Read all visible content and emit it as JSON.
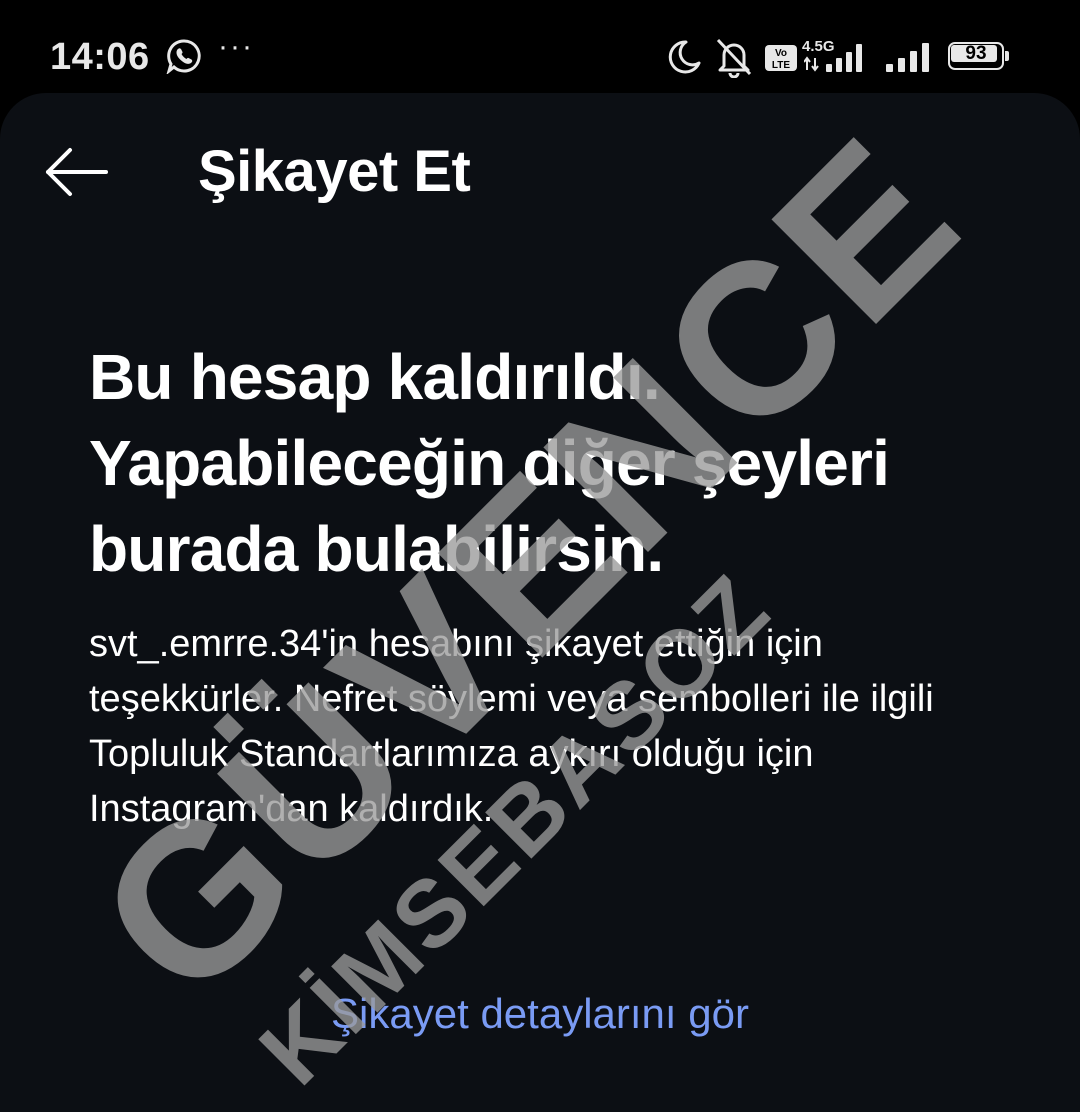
{
  "status_bar": {
    "time": "14:06",
    "dots": "···",
    "network_label": "4.5G",
    "volte_label": "Vo LTE",
    "battery_level": "93",
    "icons": [
      "whatsapp-icon",
      "moon-icon",
      "bell-muted-icon",
      "volte-icon",
      "signal-icon",
      "battery-icon"
    ]
  },
  "header": {
    "title": "Şikayet Et",
    "back_icon": "arrow-left-icon"
  },
  "main": {
    "headline": "Bu hesap kaldırıldı. Yapabileceğin diğer şeyleri burada bulabilirsin.",
    "body": "svt_.emrre.34'in hesabını şikayet ettiğin için teşekkürler. Nefret söylemi veya sembolleri ile ilgili Topluluk Standartlarımıza aykırı olduğu için Instagram'dan kaldırdık.",
    "details_link": "Şikayet detaylarını gör"
  },
  "watermark": {
    "primary": "GÜVENCE",
    "secondary": "KİMSEBASOZ"
  },
  "colors": {
    "background": "#0c0f14",
    "status_bar": "#000000",
    "text": "#ffffff",
    "link": "#7a9bf4",
    "watermark": "#8a8a8a"
  }
}
